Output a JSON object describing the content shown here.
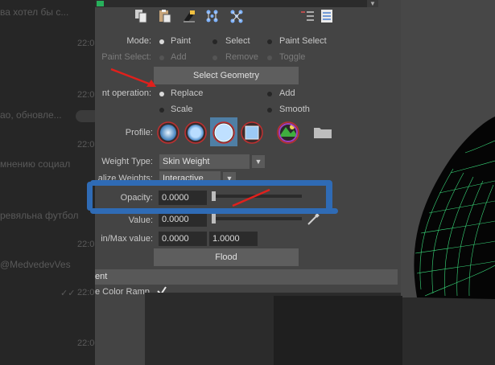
{
  "chat_background": {
    "lines": [
      "ва хотел бы с...",
      "ао, обновле...",
      "мнению социал",
      "ревяльна футбол",
      "@MedvedevVes"
    ],
    "times": [
      "22:0",
      "22:0",
      "22:0",
      "22:0",
      "22:0",
      "22:00"
    ]
  },
  "toolbar": {
    "icons": [
      "copy-settings-icon",
      "paste-settings-icon",
      "reset-tool-icon",
      "joint-grid-icon",
      "joint-tree-icon",
      "list-sort-icon",
      "list-icon"
    ]
  },
  "mode": {
    "label": "Mode:",
    "options": [
      "Paint",
      "Select",
      "Paint Select"
    ],
    "selected": "Paint"
  },
  "paint_select": {
    "label": "Paint Select:",
    "options": [
      "Add",
      "Remove",
      "Toggle"
    ]
  },
  "select_geometry_button": "Select Geometry",
  "paint_operation": {
    "label": "nt operation:",
    "options": [
      "Replace",
      "Add",
      "Scale",
      "Smooth"
    ],
    "selected": "Replace"
  },
  "profile": {
    "label": "Profile:",
    "shapes": [
      "gaussian-brush-icon",
      "soft-brush-icon",
      "solid-brush-icon",
      "square-brush-icon",
      "image-brush-icon",
      "folder-icon"
    ],
    "selected_index": 2
  },
  "weight_type": {
    "label": "Weight Type:",
    "value": "Skin Weight"
  },
  "normalize_weights": {
    "label": "alize Weights:",
    "value": "Interactive"
  },
  "opacity": {
    "label": "Opacity:",
    "value": "0.0000",
    "level": 0
  },
  "value_field": {
    "label": "Value:",
    "value": "0.0000",
    "level": 0
  },
  "min_max": {
    "label": "in/Max value:",
    "min": "0.0000",
    "max": "1.0000"
  },
  "flood_button": "Flood",
  "section": {
    "title": "ent",
    "use_color_ramp_label": "e Color Ramp",
    "use_color_ramp_checked": true
  },
  "colors": {
    "panel": "#444444",
    "field": "#2b2b2b",
    "button": "#5e5e5e",
    "annotation_blue": "#2f6bb5",
    "annotation_red": "#e0201c",
    "wireframe": "#39d97a"
  }
}
